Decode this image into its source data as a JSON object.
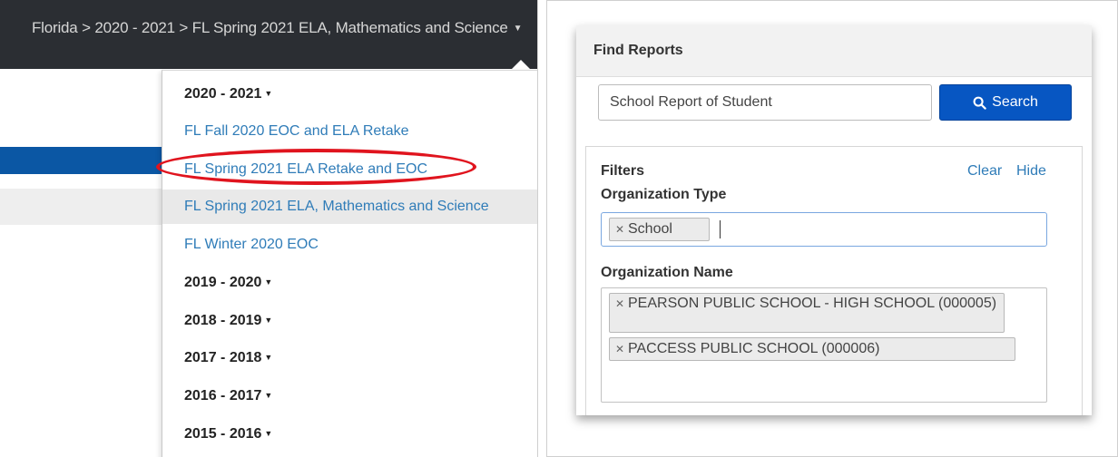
{
  "left": {
    "breadcrumb": "Florida > 2020 - 2021 > FL Spring 2021 ELA, Mathematics and Science",
    "menu": [
      {
        "label": "2020 - 2021",
        "type": "year",
        "caret": "▼"
      },
      {
        "label": "FL Fall 2020 EOC and ELA Retake",
        "type": "test"
      },
      {
        "label": "FL Spring 2021 ELA Retake and EOC",
        "type": "test",
        "circled": true
      },
      {
        "label": "FL Spring 2021 ELA, Mathematics and Science",
        "type": "test",
        "active": true
      },
      {
        "label": "FL Winter 2020 EOC",
        "type": "test"
      },
      {
        "label": "2019 - 2020",
        "type": "year",
        "caret": "▼"
      },
      {
        "label": "2018 - 2019",
        "type": "year",
        "caret": "▼"
      },
      {
        "label": "2017 - 2018",
        "type": "year",
        "caret": "▼"
      },
      {
        "label": "2016 - 2017",
        "type": "year",
        "caret": "▼"
      },
      {
        "label": "2015 - 2016",
        "type": "year",
        "caret": "▼"
      }
    ]
  },
  "right": {
    "title": "Find Reports",
    "search": {
      "value": "School Report of Student",
      "button_label": "Search"
    },
    "filters": {
      "title": "Filters",
      "clear": "Clear",
      "hide": "Hide",
      "org_type_label": "Organization Type",
      "org_type_tags": [
        "School"
      ],
      "org_name_label": "Organization Name",
      "org_name_tags": [
        "PEARSON PUBLIC SCHOOL - HIGH SCHOOL (000005)",
        "PACCESS PUBLIC SCHOOL (000006)"
      ]
    }
  },
  "colors": {
    "topbar": "#2b2e33",
    "accent_blue": "#0756c2",
    "link_blue": "#2f7cb8",
    "highlight_red": "#e0141e"
  },
  "icons": {
    "breadcrumb_caret": "caret-down-icon",
    "search": "search-icon",
    "tag_remove": "close-icon"
  }
}
